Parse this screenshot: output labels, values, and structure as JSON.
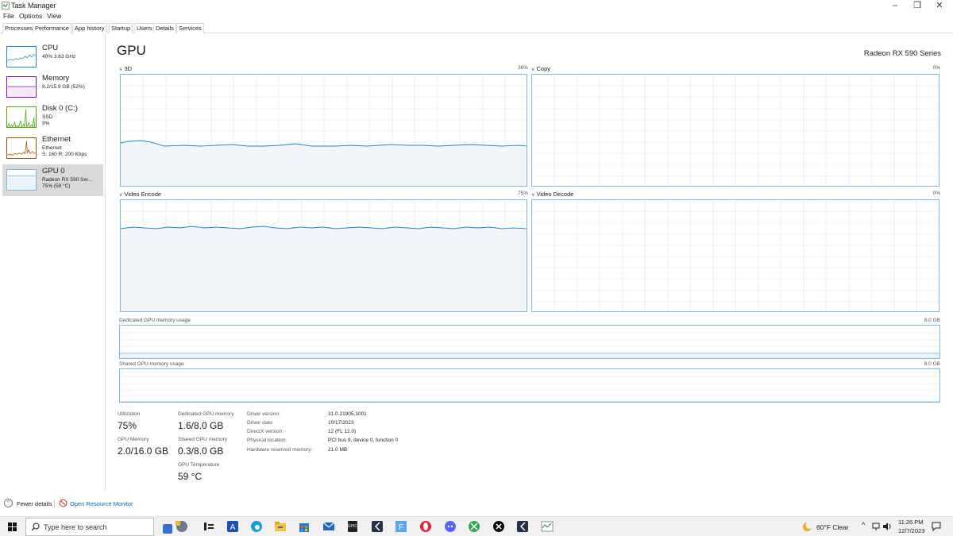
{
  "window": {
    "title": "Task Manager"
  },
  "menu": [
    "File",
    "Options",
    "View"
  ],
  "tabs": [
    "Processes",
    "Performance",
    "App history",
    "Startup",
    "Users",
    "Details",
    "Services"
  ],
  "sidebar": [
    {
      "name": "CPU",
      "line1": "40% 3.63 GHz",
      "line2": "",
      "line3": ""
    },
    {
      "name": "Memory",
      "line1": "8.2/15.9 GB (52%)",
      "line2": "",
      "line3": ""
    },
    {
      "name": "Disk 0 (C:)",
      "line1": "SSD",
      "line2": "9%",
      "line3": ""
    },
    {
      "name": "Ethernet",
      "line1": "Ethernet",
      "line2": "S: 160 R: 200 Kbps",
      "line3": ""
    },
    {
      "name": "GPU 0",
      "line1": "Radeon RX 590 Ser...",
      "line2": "75% (59 °C)",
      "line3": ""
    }
  ],
  "main": {
    "title": "GPU",
    "model": "Radeon RX 590 Series",
    "engines": [
      {
        "label": "3D",
        "pct": "36%"
      },
      {
        "label": "Copy",
        "pct": "0%"
      },
      {
        "label": "Video Encode",
        "pct": "75%"
      },
      {
        "label": "Video Decode",
        "pct": "0%"
      }
    ],
    "dedicated_label": "Dedicated GPU memory usage",
    "dedicated_max": "8.0 GB",
    "shared_label": "Shared GPU memory usage",
    "shared_max": "8.0 GB"
  },
  "stats": {
    "utilization_label": "Utilization",
    "utilization_value": "75%",
    "dedicated_label": "Dedicated GPU memory",
    "dedicated_value": "1.6/8.0 GB",
    "gpu_memory_label": "GPU Memory",
    "gpu_memory_value": "2.0/16.0 GB",
    "shared_label": "Shared GPU memory",
    "shared_value": "0.3/8.0 GB",
    "temp_label": "GPU Temperature",
    "temp_value": "59 °C"
  },
  "info": [
    {
      "label": "Driver version:",
      "value": "31.0.21905.1001"
    },
    {
      "label": "Driver date:",
      "value": "10/17/2023"
    },
    {
      "label": "DirectX version:",
      "value": "12 (FL 12.0)"
    },
    {
      "label": "Physical location:",
      "value": "PCI bus 9, device 0, function 0"
    },
    {
      "label": "Hardware reserved memory:",
      "value": "21.0 MB"
    }
  ],
  "footer": {
    "fewer_details": "Fewer details",
    "open_monitor": "Open Resource Monitor"
  },
  "taskbar": {
    "search_placeholder": "Type here to search",
    "weather": "60°F  Clear",
    "time": "11:26 PM",
    "date": "12/7/2023"
  },
  "colors": {
    "gpu_line": "#1b88c8",
    "gpu_fill": "#f1f6fb",
    "gpu_border": "#7eb8dd",
    "cpu": "#1b88c8",
    "memory": "#8b12ae",
    "disk": "#4da60c",
    "ethernet": "#a74f01"
  }
}
